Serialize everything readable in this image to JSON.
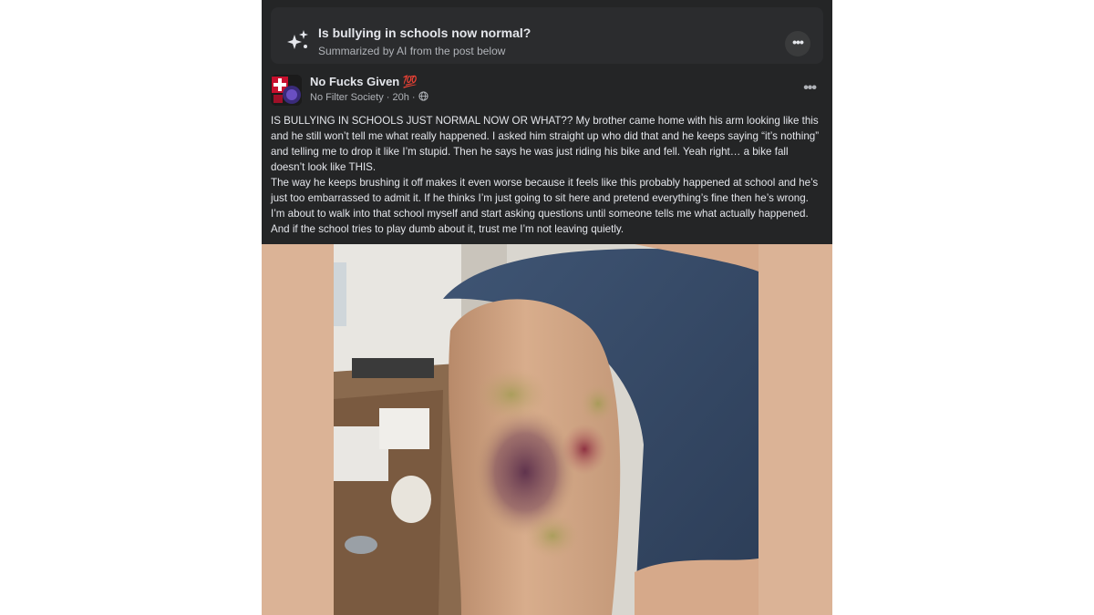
{
  "summary": {
    "title": "Is bullying in schools now normal?",
    "subtitle": "Summarized by AI from the post below",
    "icon": "ai-sparkle-icon",
    "more_icon": "•••"
  },
  "post": {
    "page_name": "No Fucks Given",
    "page_emoji": "💯",
    "source_group": "No Filter Society",
    "separator": "·",
    "time": "20h",
    "audience_icon": "globe-icon",
    "more_icon": "•••",
    "paragraphs": [
      "IS BULLYING IN SCHOOLS JUST NORMAL NOW OR WHAT?? My brother came home with his arm looking like this and he still won’t tell me what really happened. I asked him straight up who did that and he keeps saying “it’s nothing” and telling me to drop it like I’m stupid. Then he says he was just riding his bike and fell. Yeah right… a bike fall doesn’t look like THIS.",
      "The way he keeps brushing it off makes it even worse because it feels like this probably happened at school and he’s just too embarrassed to admit it. If he thinks I’m just going to sit here and pretend everything’s fine then he’s wrong. I’m about to walk into that school myself and start asking questions until someone tells me what actually happened. And if the school tries to play dumb about it, trust me I’m not leaving quietly."
    ],
    "photo": "bruised-arm-photo"
  },
  "colors": {
    "card_bg": "#242526",
    "summary_bg": "#2b2c2e",
    "text_primary": "#e4e6eb",
    "text_secondary": "#b0b3b8",
    "photo_backdrop": "#dbb396"
  }
}
